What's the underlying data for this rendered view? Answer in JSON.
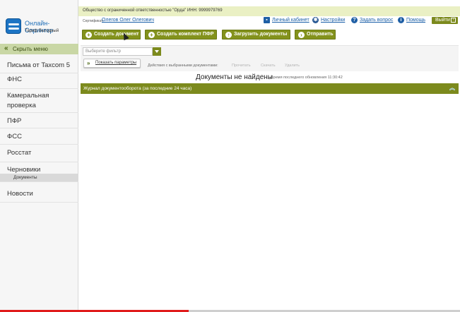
{
  "app": {
    "name": "Онлайн-Спринтер",
    "tariff": "Тариф Выгодный"
  },
  "sidebar": {
    "hide_menu_label": "Скрыть меню",
    "items": [
      {
        "label": "Письма от Taxcom 5"
      },
      {
        "label": "ФНС"
      },
      {
        "label": "Камеральная проверка"
      },
      {
        "label": "ПФР"
      },
      {
        "label": "ФСС"
      },
      {
        "label": "Росстат"
      },
      {
        "label": "Черновики"
      },
      {
        "label": "Документы"
      },
      {
        "label": "Новости"
      }
    ]
  },
  "header": {
    "organization": "Общество с ограниченной ответственностью \"Орда\" ИНН: 9999979769",
    "certificate_label": "Сертификат:",
    "certificate_owner": "Олегов Олег Олегович",
    "links": {
      "cabinet": "Личный кабинет",
      "settings": "Настройки",
      "ask": "Задать вопрос",
      "help": "Помощь"
    },
    "exit_label": "Выйти"
  },
  "toolbar": {
    "create_document": "Создать документ",
    "create_pfr": "Создать комплект ПФР",
    "upload_documents": "Загрузить документы",
    "send": "Отправить"
  },
  "filter": {
    "placeholder": "Выберите фильтр",
    "show_params": "Показать параметры",
    "actions_label": "Действия с выбранными документами:",
    "actions": [
      "Прочитать",
      "Скачать",
      "Удалить"
    ]
  },
  "content": {
    "empty_message": "Документы не найдены",
    "last_update": "Время последнего обновления 11:30:42",
    "journal_title": "Журнал документооборота (за последние 24 часа)"
  },
  "video": {
    "progress_fraction": 0.41
  },
  "icons": {
    "hide_menu": "double-chevron-left-icon",
    "cabinet": "id-card-icon",
    "settings": "gear-icon",
    "ask": "question-icon",
    "help": "info-icon",
    "exit": "exit-icon",
    "journal_toggle": "double-chevron-up-icon"
  },
  "colors": {
    "accent": "#83921c",
    "topbar": "#eaf0c4",
    "link": "#1a5fa8",
    "brand": "#1f6fb8"
  }
}
